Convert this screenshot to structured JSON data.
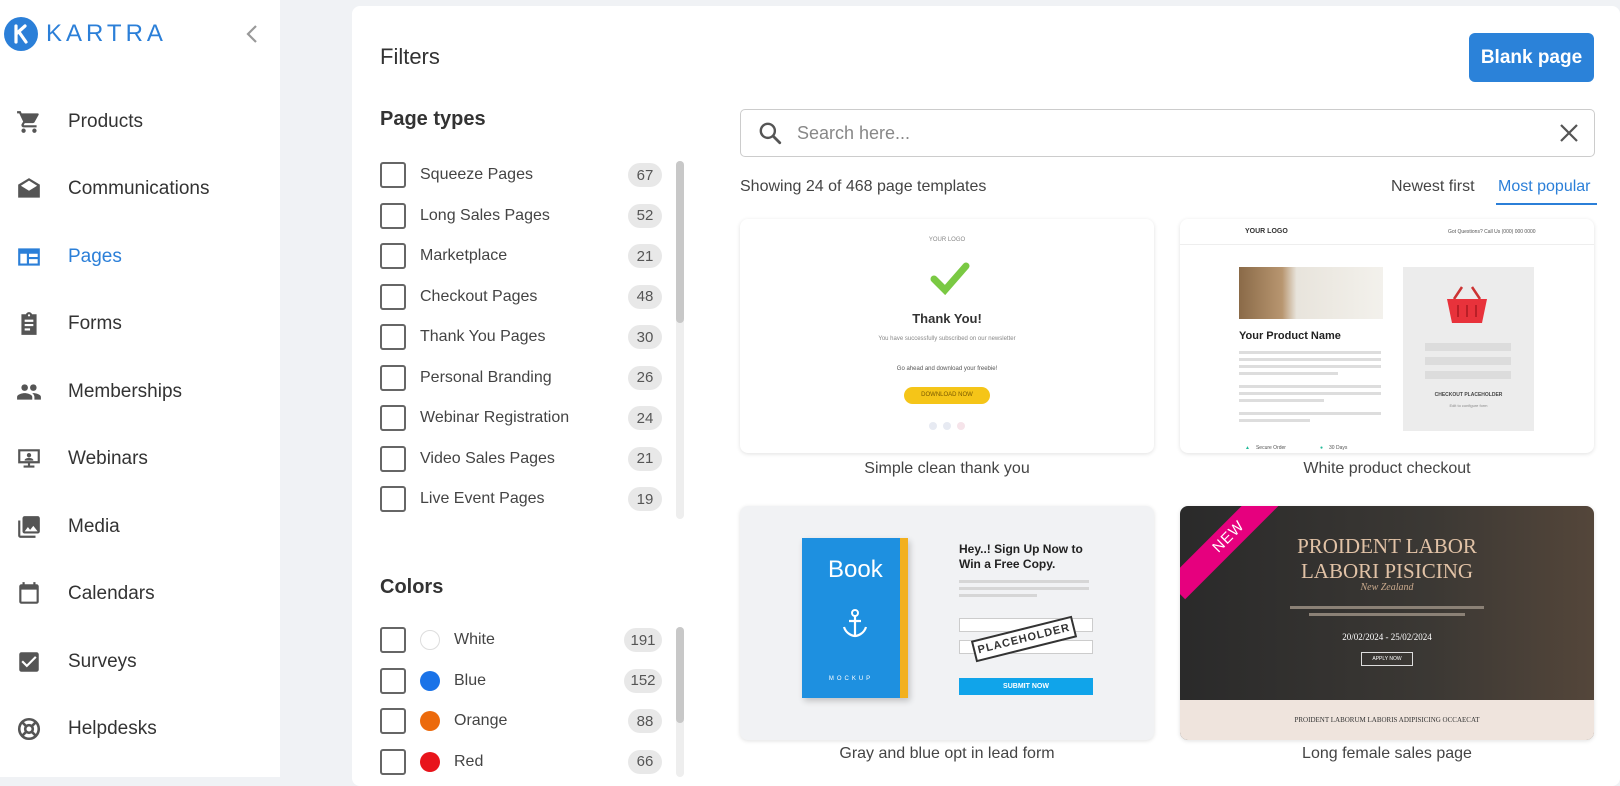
{
  "app": {
    "brand": "KARTRA",
    "brand_color": "#2b7fd8"
  },
  "sidebar": {
    "items": [
      {
        "label": "Products",
        "icon": "cart-icon"
      },
      {
        "label": "Communications",
        "icon": "envelope-icon"
      },
      {
        "label": "Pages",
        "icon": "page-layout-icon",
        "active": true
      },
      {
        "label": "Forms",
        "icon": "clipboard-icon"
      },
      {
        "label": "Memberships",
        "icon": "people-icon"
      },
      {
        "label": "Webinars",
        "icon": "presentation-icon"
      },
      {
        "label": "Media",
        "icon": "images-icon"
      },
      {
        "label": "Calendars",
        "icon": "calendar-icon"
      },
      {
        "label": "Surveys",
        "icon": "checkbox-icon"
      },
      {
        "label": "Helpdesks",
        "icon": "lifebuoy-icon"
      }
    ]
  },
  "filters": {
    "title": "Filters",
    "page_types_title": "Page types",
    "page_types": [
      {
        "label": "Squeeze Pages",
        "count": "67"
      },
      {
        "label": "Long Sales Pages",
        "count": "52"
      },
      {
        "label": "Marketplace",
        "count": "21"
      },
      {
        "label": "Checkout Pages",
        "count": "48"
      },
      {
        "label": "Thank You Pages",
        "count": "30"
      },
      {
        "label": "Personal Branding",
        "count": "26"
      },
      {
        "label": "Webinar Registration",
        "count": "24"
      },
      {
        "label": "Video Sales Pages",
        "count": "21"
      },
      {
        "label": "Live Event Pages",
        "count": "19"
      }
    ],
    "colors_title": "Colors",
    "colors": [
      {
        "label": "White",
        "count": "191",
        "swatch": "#ffffff"
      },
      {
        "label": "Blue",
        "count": "152",
        "swatch": "#1a73e8"
      },
      {
        "label": "Orange",
        "count": "88",
        "swatch": "#ec6a0c"
      },
      {
        "label": "Red",
        "count": "66",
        "swatch": "#e8141b"
      }
    ]
  },
  "toolbar": {
    "blank_page_label": "Blank page"
  },
  "search": {
    "placeholder": "Search here...",
    "value": ""
  },
  "results": {
    "showing_text": "Showing 24 of 468 page templates",
    "sort_newest": "Newest first",
    "sort_popular": "Most popular",
    "sort_active": "Most popular"
  },
  "templates": [
    {
      "caption": "Simple clean thank you",
      "preview": {
        "logo": "YOUR LOGO",
        "heading": "Thank You!",
        "line1": "You have successfully subscribed on our newsletter",
        "line2": "Go ahead and download your freebie!",
        "button": "DOWNLOAD NOW"
      }
    },
    {
      "caption": "White product checkout",
      "preview": {
        "logo": "YOUR LOGO",
        "contact": "Got Questions? Call Us (000) 000 0000",
        "product": "Your Product Name",
        "checkout": "CHECKOUT PLACEHOLDER",
        "checkout_sub": "Edit to configure form",
        "secure": "Secure Order",
        "days": "30 Days"
      }
    },
    {
      "caption": "Gray and blue opt in lead form",
      "preview": {
        "book_title": "Book",
        "book_sub": "MOCKUP",
        "heading": "Hey..! Sign Up Now to Win a Free Copy.",
        "placeholder_stamp": "PLACEHOLDER",
        "submit": "SUBMIT NOW"
      }
    },
    {
      "caption": "Long female sales page",
      "preview": {
        "ribbon": "NEW",
        "title_line1": "PROIDENT LABOR",
        "title_line2": "LABORI PISICING",
        "script": "New Zealand",
        "dates": "20/02/2024 - 25/02/2024",
        "apply": "APPLY NOW",
        "footer": "PROIDENT LABORUM LABORIS ADIPISICING OCCAECAT"
      }
    }
  ]
}
